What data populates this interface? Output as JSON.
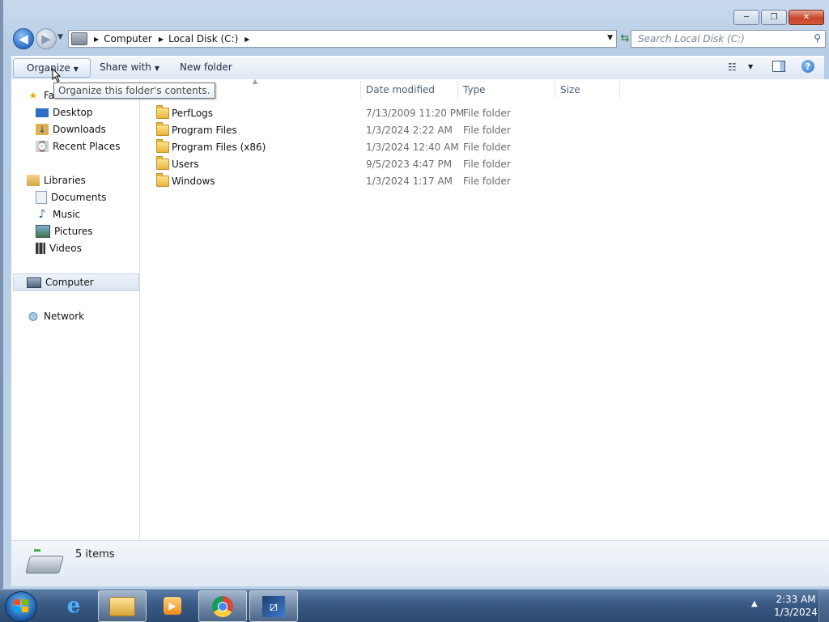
{
  "window": {
    "controls": {
      "minimize": "─",
      "maximize": "❐",
      "close": "✕"
    }
  },
  "address_bar": {
    "crumbs": [
      "Computer",
      "Local Disk (C:)"
    ],
    "search_placeholder": "Search Local Disk (C:)"
  },
  "toolbar": {
    "organize": "Organize",
    "share_with": "Share with",
    "new_folder": "New folder"
  },
  "tooltip": "Organize this folder's contents.",
  "nav_pane": {
    "favorites_label": "Favorites",
    "favorites": [
      "Desktop",
      "Downloads",
      "Recent Places"
    ],
    "libraries_label": "Libraries",
    "libraries": [
      "Documents",
      "Music",
      "Pictures",
      "Videos"
    ],
    "computer_label": "Computer",
    "network_label": "Network"
  },
  "columns": {
    "date": "Date modified",
    "type": "Type",
    "size": "Size"
  },
  "files": [
    {
      "name": "PerfLogs",
      "date": "7/13/2009 11:20 PM",
      "type": "File folder"
    },
    {
      "name": "Program Files",
      "date": "1/3/2024 2:22 AM",
      "type": "File folder"
    },
    {
      "name": "Program Files (x86)",
      "date": "1/3/2024 12:40 AM",
      "type": "File folder"
    },
    {
      "name": "Users",
      "date": "9/5/2023 4:47 PM",
      "type": "File folder"
    },
    {
      "name": "Windows",
      "date": "1/3/2024 1:17 AM",
      "type": "File folder"
    }
  ],
  "status": {
    "items": "5 items"
  },
  "taskbar": {
    "time": "2:33 AM",
    "date": "1/3/2024",
    "apps": [
      "internet-explorer-icon",
      "windows-explorer-icon",
      "media-player-icon",
      "chrome-icon",
      "kdenlive-icon"
    ]
  }
}
